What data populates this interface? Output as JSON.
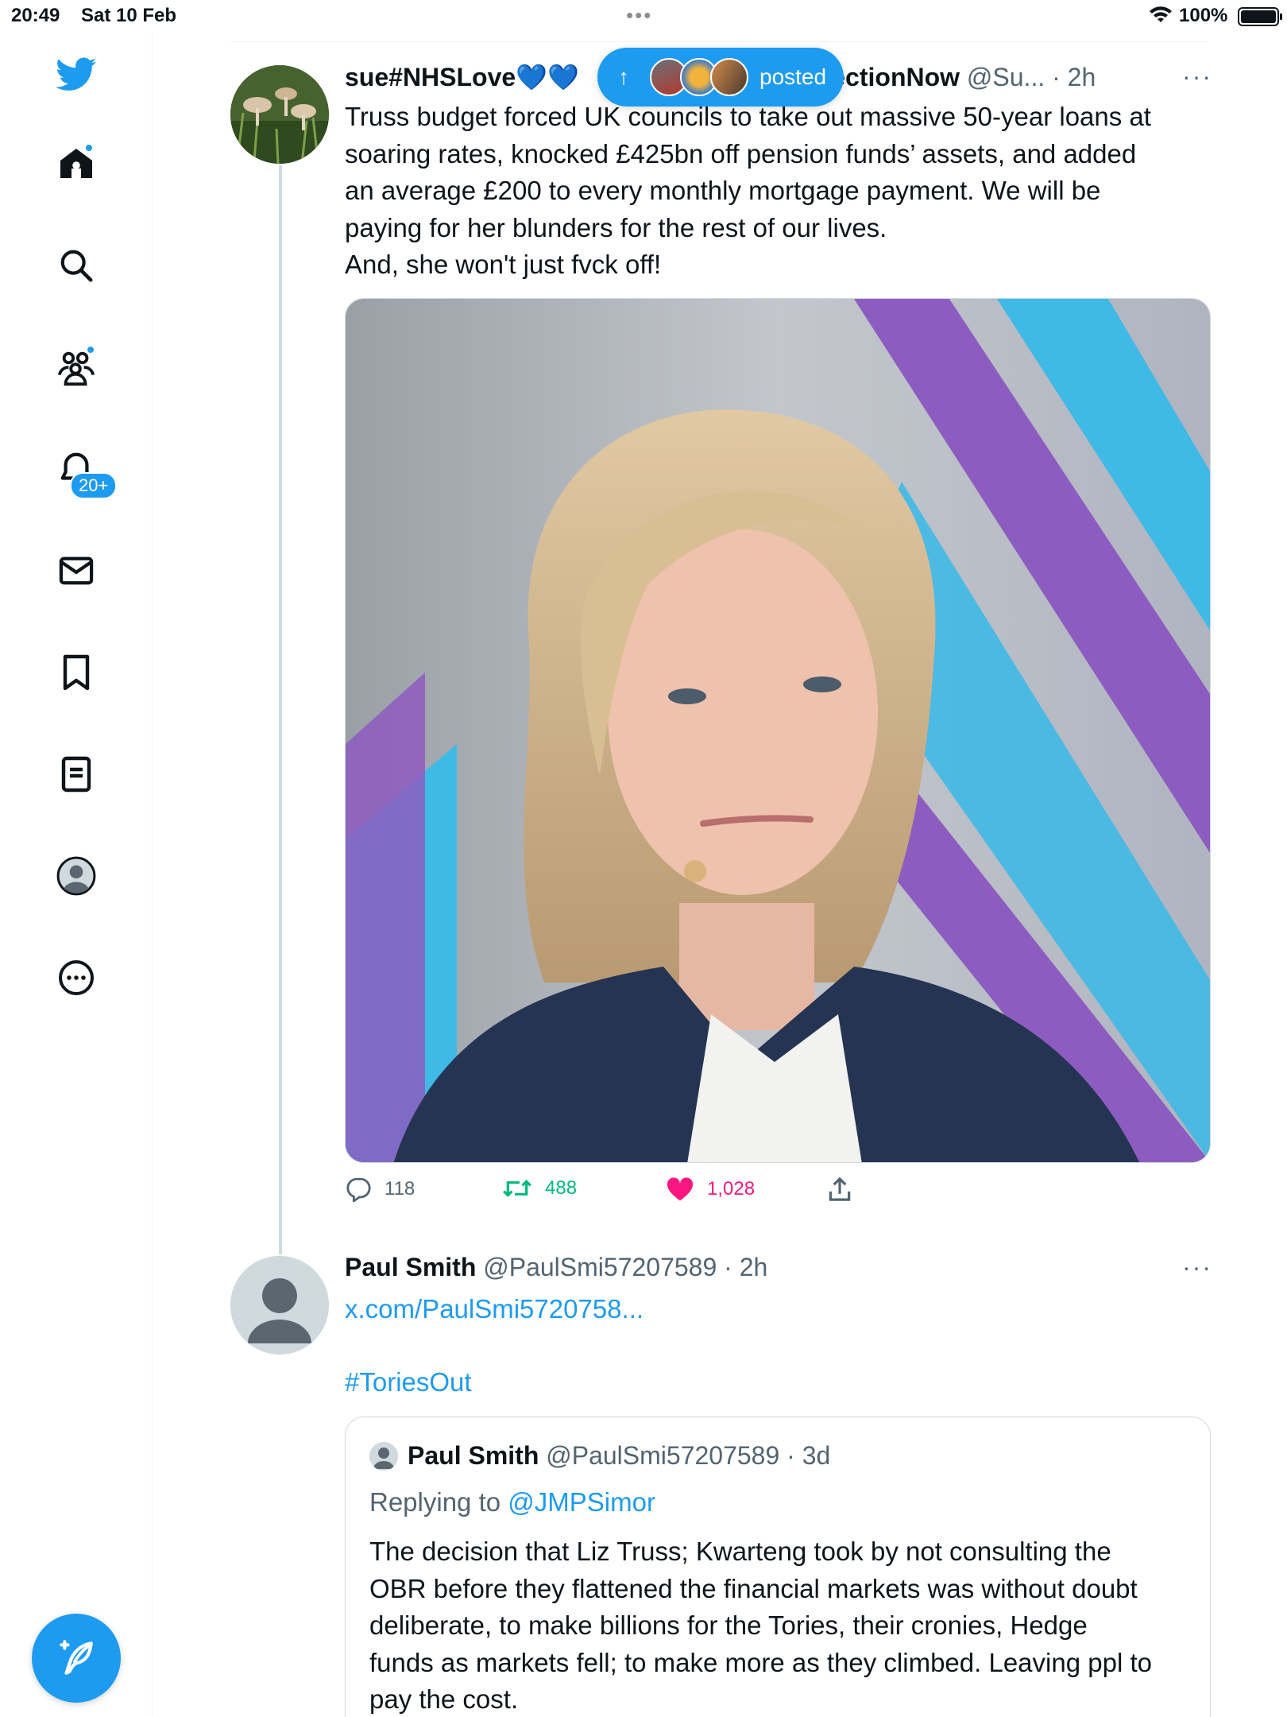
{
  "status_bar": {
    "time": "20:49",
    "date": "Sat 10 Feb",
    "dots": "•••",
    "battery": "100%"
  },
  "sidebar": {
    "notifications_badge": "20+",
    "items": [
      "twitter-logo",
      "home",
      "explore",
      "communities",
      "notifications",
      "messages",
      "bookmarks",
      "lists",
      "profile",
      "more"
    ]
  },
  "posted_pill": {
    "arrow": "↑",
    "label": "posted"
  },
  "tweet1": {
    "name": "sue#NHSLove💙💙",
    "name_tail": "ralElectionNow",
    "handle": "@Su...",
    "time": "2h",
    "text_lines": [
      "Truss budget forced UK councils to take out massive 50-year loans at",
      "soaring rates, knocked £425bn off pension funds’ assets, and added",
      "an average £200 to every monthly mortgage payment. We will be",
      "paying for her blunders for the rest of our lives.",
      "And, she won't just fvck off!"
    ],
    "stats": {
      "replies": "118",
      "retweets": "488",
      "likes": "1,028"
    }
  },
  "tweet2": {
    "name": "Paul Smith",
    "handle": "@PaulSmi57207589",
    "time": "2h",
    "link": "x.com/PaulSmi5720758...",
    "hashtag": "#ToriesOut",
    "quote": {
      "name": "Paul Smith",
      "handle": "@PaulSmi57207589",
      "time": "3d",
      "replying_prefix": "Replying to",
      "replying_to": "@JMPSimor",
      "text_lines": [
        "The decision that Liz Truss;  Kwarteng took by not consulting the",
        "OBR before they flattened the financial markets was without doubt",
        "deliberate, to make billions for the Tories, their cronies, Hedge",
        "funds as markets fell; to make more as they climbed. Leaving ppl to",
        "pay the cost."
      ]
    }
  },
  "colors": {
    "accent": "#1d9bf0",
    "retweet": "#00ba7c",
    "like": "#f91880",
    "muted": "#536471"
  }
}
